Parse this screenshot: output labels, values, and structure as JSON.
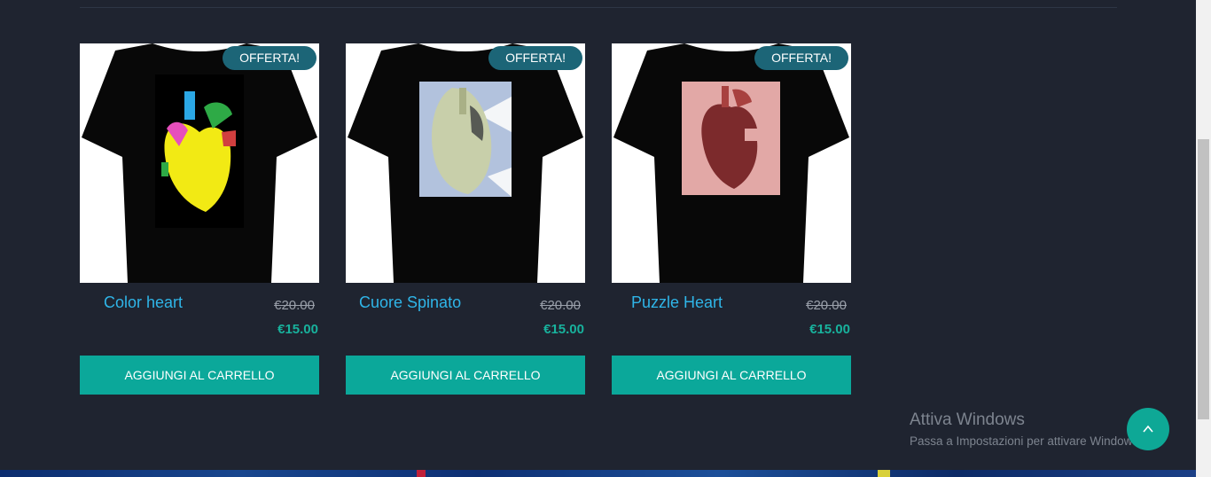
{
  "badge_label": "OFFERTA!",
  "products": [
    {
      "title": "Color heart",
      "old_price": "€20.00",
      "new_price": "€15.00",
      "add_label": "AGGIUNGI AL CARRELLO"
    },
    {
      "title": "Cuore Spinato",
      "old_price": "€20.00",
      "new_price": "€15.00",
      "add_label": "AGGIUNGI AL CARRELLO"
    },
    {
      "title": "Puzzle Heart",
      "old_price": "€20.00",
      "new_price": "€15.00",
      "add_label": "AGGIUNGI AL CARRELLO"
    }
  ],
  "watermark": {
    "title": "Attiva Windows",
    "subtitle": "Passa a Impostazioni per attivare Windows."
  },
  "colors": {
    "background": "#1f2430",
    "badge": "#1c6577",
    "title_link": "#2fb5e8",
    "price": "#18b29d",
    "button": "#0ba89a"
  },
  "icons": {
    "scroll_top": "chevron-up-icon"
  }
}
